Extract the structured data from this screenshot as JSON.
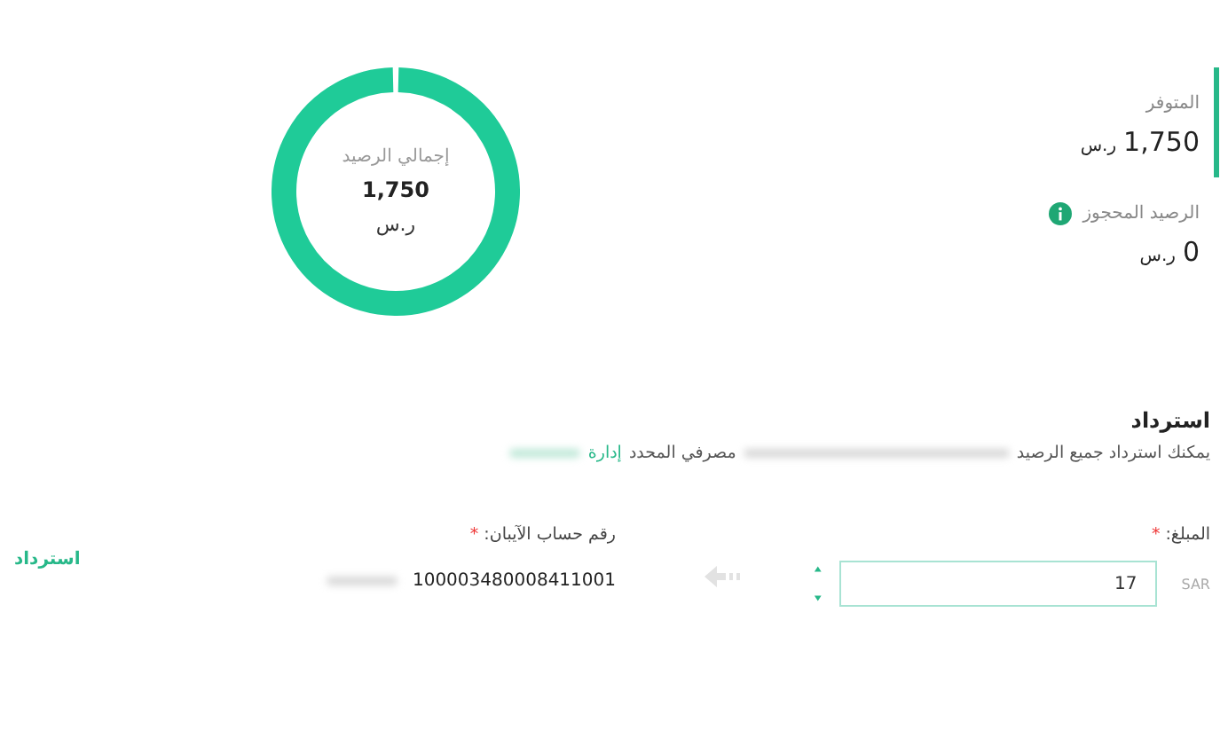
{
  "balance": {
    "available_label": "المتوفر",
    "available_amount": "1,750",
    "available_currency": "ر.س",
    "reserved_label": "الرصيد المحجوز",
    "reserved_amount": "0",
    "reserved_currency": "ر.س"
  },
  "donut": {
    "label": "إجمالي الرصيد",
    "amount": "1,750",
    "currency": "ر.س"
  },
  "refund": {
    "title": "استرداد",
    "description_start": "يمكنك استرداد جميع الرصيد",
    "description_end": "مصرفي المحدد",
    "manage_link": "إدارة",
    "amount_label": "المبلغ:",
    "required_mark": "*",
    "currency_code": "SAR",
    "amount_value": "17",
    "iban_label": "رقم حساب الآيبان:",
    "iban_value": "100003480008411001",
    "submit": "استرداد"
  }
}
